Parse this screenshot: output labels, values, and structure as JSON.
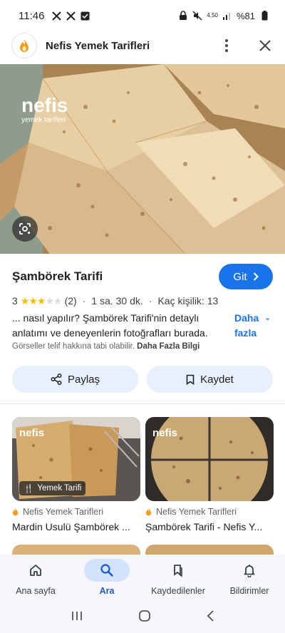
{
  "status_bar": {
    "time": "11:46",
    "battery_text": "%81",
    "network_speed": "4,50"
  },
  "header": {
    "site_name": "Nefis Yemek Tarifleri"
  },
  "hero": {
    "watermark_brand": "nefis",
    "watermark_sub": "yemek tarifleri"
  },
  "result": {
    "title": "Şambörek Tarifi",
    "go_label": "Git",
    "rating_value": "3",
    "rating_stars": 3,
    "rating_max": 5,
    "review_count": "(2)",
    "duration": "1 sa. 30 dk.",
    "servings": "Kaç kişilik: 13",
    "description": "... nasıl yapılır? Şambörek Tarifi'nin detaylı anlatımı ve deneyenlerin fotoğrafları burada.",
    "more_label_1": "Daha",
    "more_label_2": "fazla",
    "copyright_text": "Görseller telif hakkına tabi olabilir.",
    "copyright_link": "Daha Fazla Bilgi",
    "share_label": "Paylaş",
    "save_label": "Kaydet"
  },
  "related": [
    {
      "badge": "Yemek Tarifi",
      "source": "Nefis Yemek Tarifleri",
      "title": "Mardin Usulü Şambörek ..."
    },
    {
      "source": "Nefis Yemek Tarifleri",
      "title": "Şambörek Tarifi - Nefis Y..."
    }
  ],
  "bottom_nav": {
    "items": [
      {
        "label": "Ana sayfa",
        "icon": "home-icon"
      },
      {
        "label": "Ara",
        "icon": "search-icon",
        "active": true
      },
      {
        "label": "Kaydedilenler",
        "icon": "bookmark-icon"
      },
      {
        "label": "Bildirimler",
        "icon": "bell-icon"
      }
    ]
  },
  "colors": {
    "accent": "#1a73e8",
    "pill_bg": "#e8f0fe",
    "star": "#fbbc04",
    "nav_active_bg": "#d3e3fd"
  }
}
